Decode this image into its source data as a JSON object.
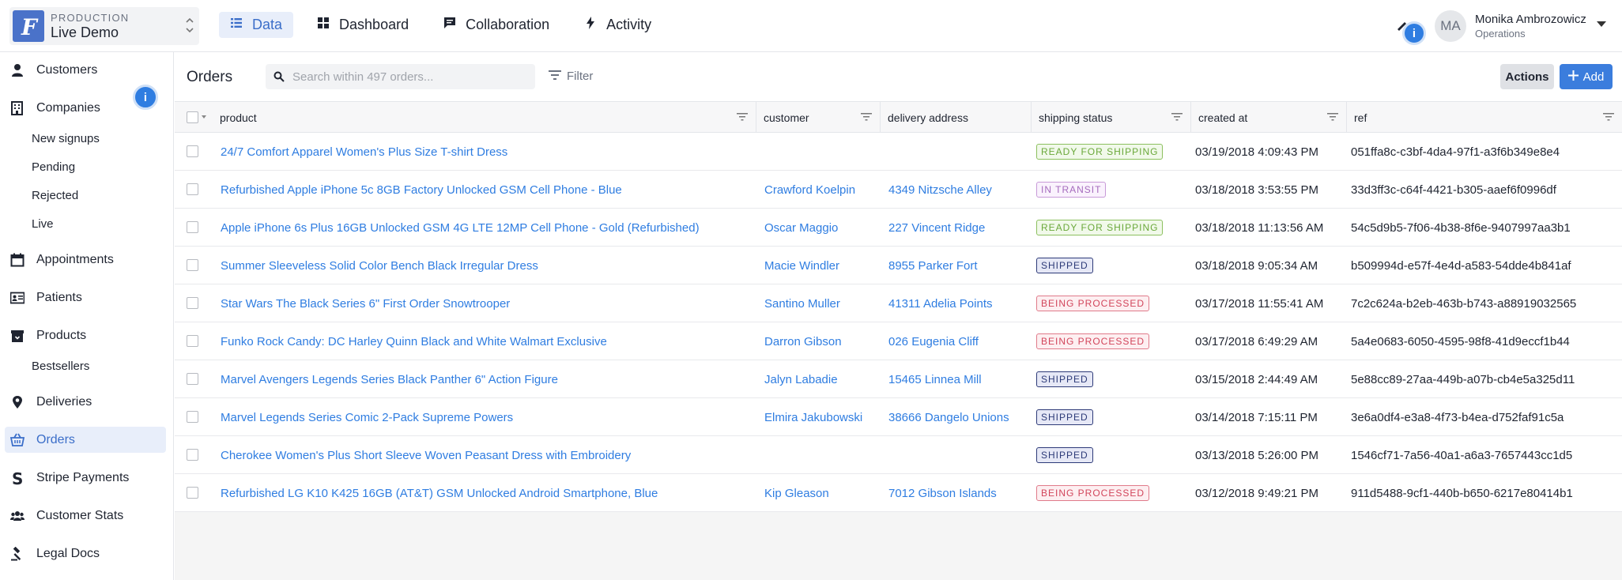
{
  "environment": {
    "label": "PRODUCTION",
    "name": "Live Demo"
  },
  "nav": [
    {
      "label": "Data",
      "icon": "list-icon"
    },
    {
      "label": "Dashboard",
      "icon": "grid-icon"
    },
    {
      "label": "Collaboration",
      "icon": "chat-icon"
    },
    {
      "label": "Activity",
      "icon": "bolt-icon"
    }
  ],
  "user": {
    "initials": "MA",
    "name": "Monika Ambrozowicz",
    "role": "Operations"
  },
  "sidebar": {
    "items": [
      {
        "label": "Customers",
        "icon": "person-icon"
      },
      {
        "label": "Companies",
        "icon": "building-icon"
      },
      {
        "label": "New signups"
      },
      {
        "label": "Pending"
      },
      {
        "label": "Rejected"
      },
      {
        "label": "Live"
      },
      {
        "label": "Appointments",
        "icon": "calendar-icon"
      },
      {
        "label": "Patients",
        "icon": "id-card-icon"
      },
      {
        "label": "Products",
        "icon": "box-icon"
      },
      {
        "label": "Bestsellers"
      },
      {
        "label": "Deliveries",
        "icon": "map-pin-icon"
      },
      {
        "label": "Orders",
        "icon": "basket-icon"
      },
      {
        "label": "Stripe Payments",
        "icon": "stripe-icon"
      },
      {
        "label": "Customer Stats",
        "icon": "users-icon"
      },
      {
        "label": "Legal Docs",
        "icon": "gavel-icon"
      }
    ],
    "info_badge": "i"
  },
  "toolbar": {
    "title": "Orders",
    "search_placeholder": "Search within 497 orders...",
    "filter_label": "Filter",
    "actions_label": "Actions",
    "add_label": "Add"
  },
  "table": {
    "columns": [
      "product",
      "customer",
      "delivery address",
      "shipping status",
      "created at",
      "ref"
    ],
    "rows": [
      {
        "product": "24/7 Comfort Apparel Women's Plus Size T-shirt Dress",
        "customer": "",
        "address": "",
        "status": "READY FOR SHIPPING",
        "created": "03/19/2018 4:09:43 PM",
        "ref": "051ffa8c-c3bf-4da4-97f1-a3f6b349e8e4"
      },
      {
        "product": "Refurbished Apple iPhone 5c 8GB Factory Unlocked GSM Cell Phone - Blue",
        "customer": "Crawford Koelpin",
        "address": "4349 Nitzsche Alley",
        "status": "IN TRANSIT",
        "created": "03/18/2018 3:53:55 PM",
        "ref": "33d3ff3c-c64f-4421-b305-aaef6f0996df"
      },
      {
        "product": "Apple iPhone 6s Plus 16GB Unlocked GSM 4G LTE 12MP Cell Phone - Gold (Refurbished)",
        "customer": "Oscar Maggio",
        "address": "227 Vincent Ridge",
        "status": "READY FOR SHIPPING",
        "created": "03/18/2018 11:13:56 AM",
        "ref": "54c5d9b5-7f06-4b38-8f6e-9407997aa3b1"
      },
      {
        "product": "Summer Sleeveless Solid Color Bench Black Irregular Dress",
        "customer": "Macie Windler",
        "address": "8955 Parker Fort",
        "status": "SHIPPED",
        "created": "03/18/2018 9:05:34 AM",
        "ref": "b509994d-e57f-4e4d-a583-54dde4b841af"
      },
      {
        "product": "Star Wars The Black Series 6\" First Order Snowtrooper",
        "customer": "Santino Muller",
        "address": "41311 Adelia Points",
        "status": "BEING PROCESSED",
        "created": "03/17/2018 11:55:41 AM",
        "ref": "7c2c624a-b2eb-463b-b743-a88919032565"
      },
      {
        "product": "Funko Rock Candy: DC Harley Quinn Black and White Walmart Exclusive",
        "customer": "Darron Gibson",
        "address": "026 Eugenia Cliff",
        "status": "BEING PROCESSED",
        "created": "03/17/2018 6:49:29 AM",
        "ref": "5a4e0683-6050-4595-98f8-41d9eccf1b44"
      },
      {
        "product": "Marvel Avengers Legends Series Black Panther 6\" Action Figure",
        "customer": "Jalyn Labadie",
        "address": "15465 Linnea Mill",
        "status": "SHIPPED",
        "created": "03/15/2018 2:44:49 AM",
        "ref": "5e88cc89-27aa-449b-a07b-cb4e5a325d11"
      },
      {
        "product": "Marvel Legends Series Comic 2-Pack Supreme Powers",
        "customer": "Elmira Jakubowski",
        "address": "38666 Dangelo Unions",
        "status": "SHIPPED",
        "created": "03/14/2018 7:15:11 PM",
        "ref": "3e6a0df4-e3a8-4f73-b4ea-d752faf91c5a"
      },
      {
        "product": "Cherokee Women's Plus Short Sleeve Woven Peasant Dress with Embroidery",
        "customer": "",
        "address": "",
        "status": "SHIPPED",
        "created": "03/13/2018 5:26:00 PM",
        "ref": "1546cf71-7a56-40a1-a6a3-7657443cc1d5"
      },
      {
        "product": "Refurbished LG K10 K425 16GB (AT&T) GSM Unlocked Android Smartphone, Blue",
        "customer": "Kip Gleason",
        "address": "7012 Gibson Islands",
        "status": "BEING PROCESSED",
        "created": "03/12/2018 9:49:21 PM",
        "ref": "911d5488-9cf1-440b-b650-6217e80414b1"
      }
    ]
  },
  "status_colors": {
    "READY FOR SHIPPING": {
      "fg": "#6aa83a",
      "bg": "#f1f9ea",
      "border": "#8cc05e"
    },
    "IN TRANSIT": {
      "fg": "#a56bbd",
      "bg": "#faf2fd",
      "border": "#c89ad8"
    },
    "SHIPPED": {
      "fg": "#2d3a78",
      "bg": "#e6e8f6",
      "border": "#2d3a78"
    },
    "BEING PROCESSED": {
      "fg": "#d2455b",
      "bg": "#fdeff1",
      "border": "#e07a8a"
    }
  },
  "colors": {
    "accent": "#2f7de1",
    "link": "#2f7de1"
  }
}
